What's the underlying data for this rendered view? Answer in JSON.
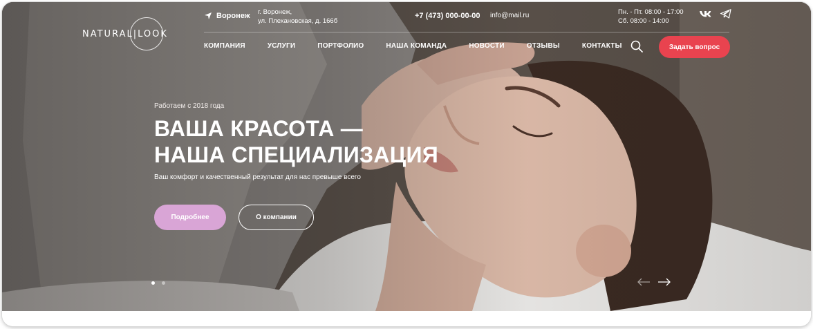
{
  "brand": {
    "logo_left": "NATURAL",
    "logo_right": "LOOK"
  },
  "header": {
    "city": "Воронеж",
    "address_line1": "г. Воронеж,",
    "address_line2": "ул. Плехановская, д. 166б",
    "phone": "+7 (473) 000-00-00",
    "email": "info@mail.ru",
    "hours_line1": "Пн. - Пт. 08:00 - 17:00",
    "hours_line2": "Сб. 08:00 - 14:00",
    "social": [
      "vk-icon",
      "telegram-icon"
    ]
  },
  "nav": {
    "items": [
      "КОМПАНИЯ",
      "УСЛУГИ",
      "ПОРТФОЛИО",
      "НАША КОМАНДА",
      "НОВОСТИ",
      "ОТЗЫВЫ",
      "КОНТАКТЫ"
    ],
    "ask_button": "Задать вопрос"
  },
  "hero": {
    "since": "Работаем с 2018 года",
    "title_line1": "ВАША КРАСОТА —",
    "title_line2": "НАША СПЕЦИАЛИЗАЦИЯ",
    "subtitle": "Ваш комфорт и качественный результат для нас превыше всего",
    "more_button": "Подробнее",
    "about_button": "О компании",
    "slides_total": 2,
    "active_slide": 1
  },
  "colors": {
    "accent_red": "#e9434f",
    "accent_pink": "#d9a5d6"
  }
}
